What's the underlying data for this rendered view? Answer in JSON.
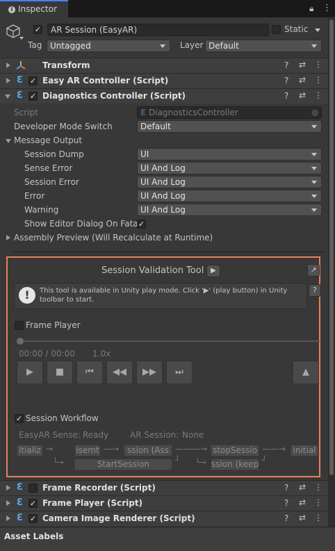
{
  "tab": {
    "title": "Inspector"
  },
  "object": {
    "name": "AR Session (EasyAR)",
    "static_label": "Static",
    "tag_label": "Tag",
    "tag_value": "Untagged",
    "layer_label": "Layer",
    "layer_value": "Default"
  },
  "components": {
    "transform": "Transform",
    "easy_ar": "Easy AR Controller (Script)",
    "diagnostics": "Diagnostics Controller (Script)",
    "frame_recorder": "Frame Recorder (Script)",
    "frame_player": "Frame Player (Script)",
    "camera_renderer": "Camera Image Renderer (Script)"
  },
  "diagnostics": {
    "script_label": "Script",
    "script_value": "DiagnosticsController",
    "dev_mode_label": "Developer Mode Switch",
    "dev_mode_value": "Default",
    "message_output_label": "Message Output",
    "session_dump_label": "Session Dump",
    "session_dump_value": "UI",
    "sense_error_label": "Sense Error",
    "sense_error_value": "UI And Log",
    "session_error_label": "Session Error",
    "session_error_value": "UI And Log",
    "error_label": "Error",
    "error_value": "UI And Log",
    "warning_label": "Warning",
    "warning_value": "UI And Log",
    "show_editor_dialog_label": "Show Editor Dialog On Fatal",
    "assembly_preview_label": "Assembly Preview (Will Recalculate at Runtime)"
  },
  "tool": {
    "title": "Session Validation Tool",
    "help_text": "This tool is available in Unity play mode. Click '▶' (play button) in Unity toolbar to start.",
    "frame_player_label": "Frame Player",
    "time": "00:00 / 00:00",
    "speed": "1.0x",
    "workflow_label": "Session Workflow",
    "easyar_sense_label": "EasyAR Sense:",
    "easyar_sense_value": "Ready",
    "ar_session_label": "AR Session:",
    "ar_session_value": "None",
    "wf_initialize": "itializ",
    "wf_assemble": "isemt",
    "wf_session_assemble": "ssion (Ass",
    "wf_stop_session": "stopSessio",
    "wf_deinitialize": "initial",
    "wf_start_session": "StartSession",
    "wf_session_keep": "ssion (keep"
  },
  "footer": {
    "asset_labels": "Asset Labels"
  },
  "colors": {
    "highlight_border": "#e8805a",
    "accent_tab": "#4c7eff",
    "script_icon": "#56a6e8"
  }
}
